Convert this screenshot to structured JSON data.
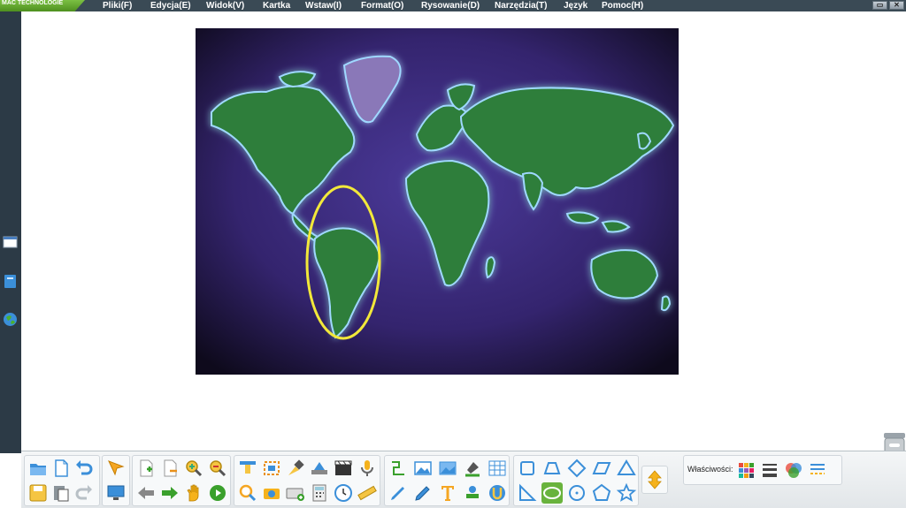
{
  "app": {
    "brand": "MAC TECHNOLOGIE"
  },
  "menu": {
    "items": [
      {
        "label": "Pliki(F)"
      },
      {
        "label": "Edycja(E)"
      },
      {
        "label": "Widok(V)"
      },
      {
        "label": "Kartka"
      },
      {
        "label": "Wstaw(I)"
      },
      {
        "label": "Format(O)"
      },
      {
        "label": "Rysowanie(D)"
      },
      {
        "label": "Narzędzia(T)"
      },
      {
        "label": "Język"
      },
      {
        "label": "Pomoc(H)"
      }
    ]
  },
  "window_buttons": {
    "minimize": "▭",
    "close": "✕"
  },
  "canvas": {
    "content": "world-map-image",
    "annotation": {
      "shape": "ellipse",
      "color": "#f2e83a",
      "target": "South America"
    }
  },
  "left_sidebar": {
    "icons": [
      "page-icon",
      "book-icon",
      "globe-icon"
    ]
  },
  "toolbar": {
    "properties_label": "Właściwości:",
    "groups": [
      {
        "name": "file",
        "icons": [
          "open-folder-icon",
          "new-page-icon",
          "undo-icon",
          "save-icon",
          "paste-icon",
          "redo-icon"
        ]
      },
      {
        "name": "view",
        "icons": [
          "select-arrow-icon",
          "screen-icon"
        ]
      },
      {
        "name": "page",
        "icons": [
          "add-page-icon",
          "delete-page-icon",
          "zoom-in-icon",
          "zoom-out-icon",
          "prev-page-icon",
          "next-page-icon",
          "hand-icon",
          "play-icon"
        ]
      },
      {
        "name": "tools",
        "icons": [
          "curtain-icon",
          "capture-icon",
          "spotlight-icon",
          "scanner-icon",
          "video-icon",
          "microphone-icon",
          "magnifier-icon",
          "camera-icon",
          "keyboard-icon",
          "calculator-icon",
          "clock-icon",
          "ruler-icon"
        ]
      },
      {
        "name": "draw",
        "icons": [
          "connector-icon",
          "image-icon",
          "background-icon",
          "fill-icon",
          "table-icon",
          "pen-icon",
          "highlighter-icon",
          "text-icon",
          "stamp-icon",
          "eraser-icon"
        ]
      },
      {
        "name": "shapes",
        "icons": [
          "square-icon",
          "trapezoid-icon",
          "diamond-icon",
          "parallelogram-icon",
          "triangle-icon",
          "right-triangle-icon",
          "ellipse-icon",
          "circle-icon",
          "pentagon-icon",
          "star-icon"
        ]
      },
      {
        "name": "toggle",
        "icons": [
          "toggle-arrows-icon"
        ]
      },
      {
        "name": "properties",
        "icons": [
          "color-palette-icon",
          "line-width-icon",
          "color-mix-icon",
          "line-style-icon"
        ]
      }
    ],
    "active_tool": "ellipse-icon"
  },
  "colors": {
    "menubar": "#3a4a55",
    "brand": "#5aa02c",
    "accent": "#69b33d",
    "icon_blue": "#3b8fd9",
    "map_ocean": "#3c2a7a"
  }
}
